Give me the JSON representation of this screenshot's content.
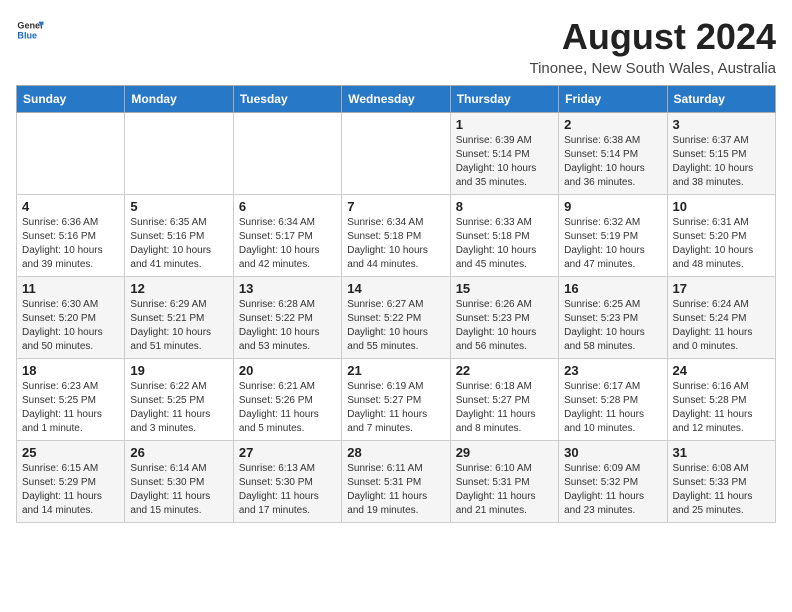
{
  "header": {
    "logo_general": "General",
    "logo_blue": "Blue",
    "month_year": "August 2024",
    "location": "Tinonee, New South Wales, Australia"
  },
  "days_of_week": [
    "Sunday",
    "Monday",
    "Tuesday",
    "Wednesday",
    "Thursday",
    "Friday",
    "Saturday"
  ],
  "weeks": [
    [
      {
        "day": "",
        "info": ""
      },
      {
        "day": "",
        "info": ""
      },
      {
        "day": "",
        "info": ""
      },
      {
        "day": "",
        "info": ""
      },
      {
        "day": "1",
        "info": "Sunrise: 6:39 AM\nSunset: 5:14 PM\nDaylight: 10 hours\nand 35 minutes."
      },
      {
        "day": "2",
        "info": "Sunrise: 6:38 AM\nSunset: 5:14 PM\nDaylight: 10 hours\nand 36 minutes."
      },
      {
        "day": "3",
        "info": "Sunrise: 6:37 AM\nSunset: 5:15 PM\nDaylight: 10 hours\nand 38 minutes."
      }
    ],
    [
      {
        "day": "4",
        "info": "Sunrise: 6:36 AM\nSunset: 5:16 PM\nDaylight: 10 hours\nand 39 minutes."
      },
      {
        "day": "5",
        "info": "Sunrise: 6:35 AM\nSunset: 5:16 PM\nDaylight: 10 hours\nand 41 minutes."
      },
      {
        "day": "6",
        "info": "Sunrise: 6:34 AM\nSunset: 5:17 PM\nDaylight: 10 hours\nand 42 minutes."
      },
      {
        "day": "7",
        "info": "Sunrise: 6:34 AM\nSunset: 5:18 PM\nDaylight: 10 hours\nand 44 minutes."
      },
      {
        "day": "8",
        "info": "Sunrise: 6:33 AM\nSunset: 5:18 PM\nDaylight: 10 hours\nand 45 minutes."
      },
      {
        "day": "9",
        "info": "Sunrise: 6:32 AM\nSunset: 5:19 PM\nDaylight: 10 hours\nand 47 minutes."
      },
      {
        "day": "10",
        "info": "Sunrise: 6:31 AM\nSunset: 5:20 PM\nDaylight: 10 hours\nand 48 minutes."
      }
    ],
    [
      {
        "day": "11",
        "info": "Sunrise: 6:30 AM\nSunset: 5:20 PM\nDaylight: 10 hours\nand 50 minutes."
      },
      {
        "day": "12",
        "info": "Sunrise: 6:29 AM\nSunset: 5:21 PM\nDaylight: 10 hours\nand 51 minutes."
      },
      {
        "day": "13",
        "info": "Sunrise: 6:28 AM\nSunset: 5:22 PM\nDaylight: 10 hours\nand 53 minutes."
      },
      {
        "day": "14",
        "info": "Sunrise: 6:27 AM\nSunset: 5:22 PM\nDaylight: 10 hours\nand 55 minutes."
      },
      {
        "day": "15",
        "info": "Sunrise: 6:26 AM\nSunset: 5:23 PM\nDaylight: 10 hours\nand 56 minutes."
      },
      {
        "day": "16",
        "info": "Sunrise: 6:25 AM\nSunset: 5:23 PM\nDaylight: 10 hours\nand 58 minutes."
      },
      {
        "day": "17",
        "info": "Sunrise: 6:24 AM\nSunset: 5:24 PM\nDaylight: 11 hours\nand 0 minutes."
      }
    ],
    [
      {
        "day": "18",
        "info": "Sunrise: 6:23 AM\nSunset: 5:25 PM\nDaylight: 11 hours\nand 1 minute."
      },
      {
        "day": "19",
        "info": "Sunrise: 6:22 AM\nSunset: 5:25 PM\nDaylight: 11 hours\nand 3 minutes."
      },
      {
        "day": "20",
        "info": "Sunrise: 6:21 AM\nSunset: 5:26 PM\nDaylight: 11 hours\nand 5 minutes."
      },
      {
        "day": "21",
        "info": "Sunrise: 6:19 AM\nSunset: 5:27 PM\nDaylight: 11 hours\nand 7 minutes."
      },
      {
        "day": "22",
        "info": "Sunrise: 6:18 AM\nSunset: 5:27 PM\nDaylight: 11 hours\nand 8 minutes."
      },
      {
        "day": "23",
        "info": "Sunrise: 6:17 AM\nSunset: 5:28 PM\nDaylight: 11 hours\nand 10 minutes."
      },
      {
        "day": "24",
        "info": "Sunrise: 6:16 AM\nSunset: 5:28 PM\nDaylight: 11 hours\nand 12 minutes."
      }
    ],
    [
      {
        "day": "25",
        "info": "Sunrise: 6:15 AM\nSunset: 5:29 PM\nDaylight: 11 hours\nand 14 minutes."
      },
      {
        "day": "26",
        "info": "Sunrise: 6:14 AM\nSunset: 5:30 PM\nDaylight: 11 hours\nand 15 minutes."
      },
      {
        "day": "27",
        "info": "Sunrise: 6:13 AM\nSunset: 5:30 PM\nDaylight: 11 hours\nand 17 minutes."
      },
      {
        "day": "28",
        "info": "Sunrise: 6:11 AM\nSunset: 5:31 PM\nDaylight: 11 hours\nand 19 minutes."
      },
      {
        "day": "29",
        "info": "Sunrise: 6:10 AM\nSunset: 5:31 PM\nDaylight: 11 hours\nand 21 minutes."
      },
      {
        "day": "30",
        "info": "Sunrise: 6:09 AM\nSunset: 5:32 PM\nDaylight: 11 hours\nand 23 minutes."
      },
      {
        "day": "31",
        "info": "Sunrise: 6:08 AM\nSunset: 5:33 PM\nDaylight: 11 hours\nand 25 minutes."
      }
    ]
  ]
}
